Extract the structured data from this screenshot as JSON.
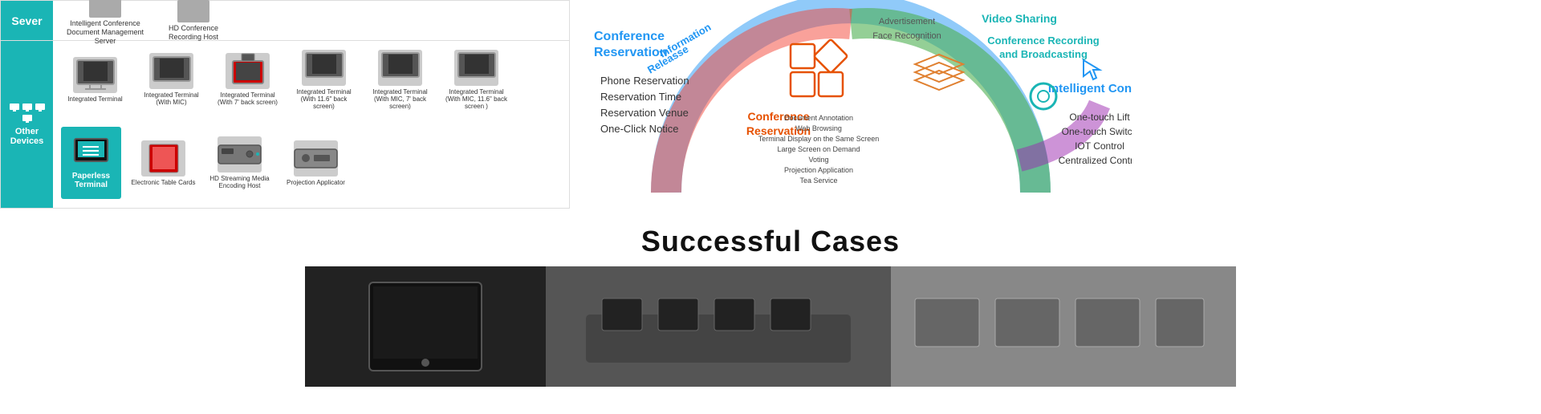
{
  "header": {
    "server_label": "Sever"
  },
  "devices": {
    "server_items": [
      "Intelligent Conference Document Management Server",
      "HD Conference Recording Host"
    ],
    "other_devices_label": "Other Devices",
    "device_list": [
      {
        "label": "Integrated Terminal",
        "type": "screen"
      },
      {
        "label": "Integrated Terminal (With MIC)",
        "type": "screen"
      },
      {
        "label": "Integrated Terminal (With 7' back screen)",
        "type": "screen_tall"
      },
      {
        "label": "Integrated Terminal (With 11.6\" back screen)",
        "type": "screen"
      },
      {
        "label": "Integrated Terminal (With MIC, 7' back screen)",
        "type": "screen"
      },
      {
        "label": "Integrated Terminal (With MIC, 11.6\" back screen )",
        "type": "screen"
      },
      {
        "label": "Paperless Terminal",
        "type": "paperless",
        "highlighted": true
      },
      {
        "label": "Electronic Table Cards",
        "type": "card"
      },
      {
        "label": "HD Streaming Media Encoding Host",
        "type": "box"
      },
      {
        "label": "Projection Applicator",
        "type": "box"
      }
    ]
  },
  "diagram": {
    "conference_reservation_title": "Conference Reservation",
    "information_release_label": "Information Releas​se",
    "phone_reservation": "Phone Reservation",
    "reservation_time": "Reservation Time",
    "reservation_venue": "Reservation Venue",
    "one_click_notice": "One-Click Notice",
    "conference_reservation_center": "Conference\nReservation",
    "doc_annotation": "Document Annotation",
    "web_browsing": "Web Browsing",
    "terminal_display": "Terminal Display on the Same Screen",
    "large_screen": "Large Screen on Demand",
    "voting": "Voting",
    "projection": "Projection Application",
    "tea_service": "Tea Service",
    "advertisement": "Advertisement",
    "face_recognition": "Face Recognition",
    "video_sharing": "Video Sharing",
    "conf_recording": "Conference Recording and Broadcasting",
    "intelligent_control_title": "Intelligent Control",
    "one_touch_lift": "One-touch Lift",
    "one_touch_switch": "One-touch Switch",
    "iot_control": "IOT Control",
    "centralized_control": "Centralized Control"
  },
  "successful_cases": {
    "title": "Successful Cases"
  },
  "colors": {
    "teal": "#1ab5b5",
    "blue": "#2196F3",
    "orange": "#e65100",
    "green": "#4CAF50",
    "red": "#f44336",
    "purple": "#9C27B0"
  }
}
